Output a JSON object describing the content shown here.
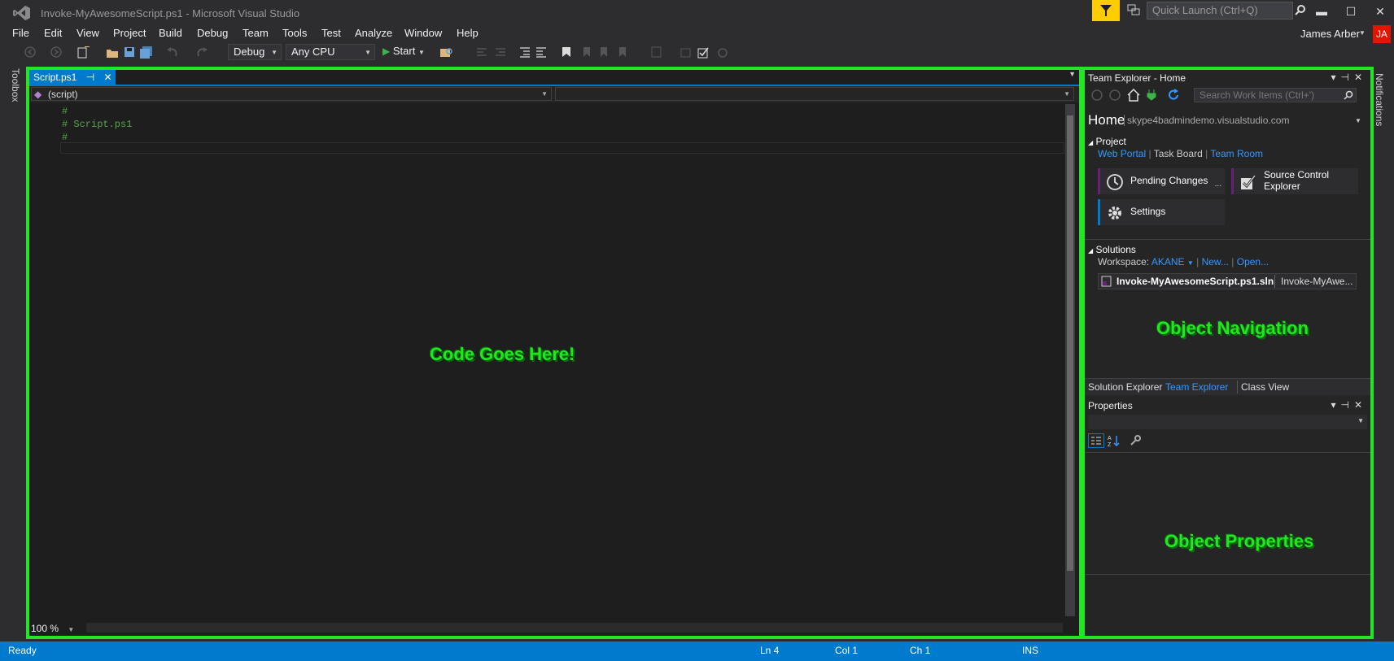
{
  "window": {
    "title": "Invoke-MyAwesomeScript.ps1 - Microsoft Visual Studio",
    "quick_launch_placeholder": "Quick Launch (Ctrl+Q)",
    "minimize": "▬",
    "maximize": "☐",
    "close": "✕"
  },
  "menu": [
    "File",
    "Edit",
    "View",
    "Project",
    "Build",
    "Debug",
    "Team",
    "Tools",
    "Test",
    "Analyze",
    "Window",
    "Help"
  ],
  "user": {
    "name": "James Arber",
    "initials": "JA"
  },
  "toolbar": {
    "configuration": "Debug",
    "platform": "Any CPU",
    "start_label": "Start"
  },
  "left_strip": {
    "toolbox": "Toolbox"
  },
  "right_strip": {
    "notifications": "Notifications"
  },
  "editor": {
    "tab_label": "Script.ps1",
    "nav_scope": "(script)",
    "code_lines": [
      "#",
      "# Script.ps1",
      "#"
    ],
    "zoom": "100 %",
    "overlay_label": "Code Goes Here!"
  },
  "team_explorer": {
    "title": "Team Explorer - Home",
    "search_placeholder": "Search Work Items (Ctrl+')",
    "home": "Home",
    "server": "skype4badmindemo.visualstudio.com",
    "project_header": "Project",
    "project_links": [
      "Web Portal",
      "Task Board",
      "Team Room"
    ],
    "tiles": {
      "pending_changes": "Pending Changes",
      "pending_more": "...",
      "source_control": "Source Control Explorer",
      "settings": "Settings"
    },
    "solutions_header": "Solutions",
    "workspace_label": "Workspace:",
    "workspace_name": "AKANE",
    "new_link": "New...",
    "open_link": "Open...",
    "solution_file": "Invoke-MyAwesomeScript.ps1.sln",
    "solution_path": "Invoke-MyAwe...",
    "overlay_label": "Object Navigation"
  },
  "bottom_tabs": [
    "Solution Explorer",
    "Team Explorer",
    "Class View"
  ],
  "properties": {
    "title": "Properties",
    "overlay_label": "Object Properties"
  },
  "status": {
    "ready": "Ready",
    "line": "Ln 4",
    "col": "Col 1",
    "ch": "Ch 1",
    "mode": "INS"
  },
  "colors": {
    "accent": "#007acc",
    "highlight_outline": "#22e622",
    "filter": "#ffcc00",
    "avatar": "#e51400",
    "code_comment": "#57a64a",
    "link": "#3399ff"
  }
}
